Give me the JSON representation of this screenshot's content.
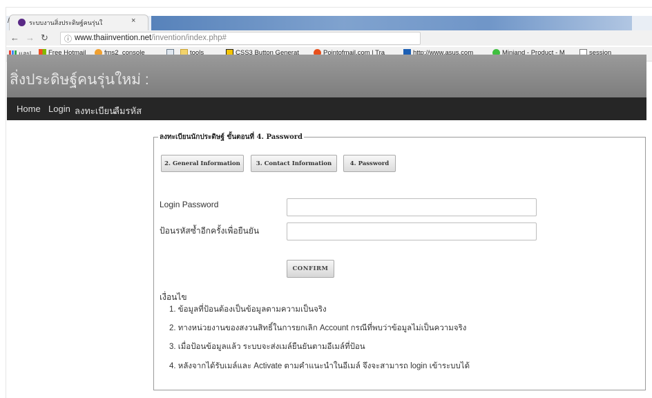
{
  "browser": {
    "tab_lead": "/",
    "tab_title": "ระบบงานสิ่งประดิษฐ์คนรุ่นใ",
    "tab_close": "×",
    "url_host": "www.thaiinvention.net",
    "url_path": "/invention/index.php#",
    "bookmarks": [
      {
        "label": "แอป",
        "icon": "apps-icon"
      },
      {
        "label": "Free Hotmail",
        "icon": "windows-icon"
      },
      {
        "label": "fms2_console",
        "icon": "flower-icon"
      },
      {
        "label": "",
        "icon": "image-icon"
      },
      {
        "label": "tools",
        "icon": "folder-icon"
      },
      {
        "label": "CSS3 Button Generat",
        "icon": "css-icon"
      },
      {
        "label": "Pointofmail.com | Tra",
        "icon": "circle-icon"
      },
      {
        "label": "http://www.asus.com",
        "icon": "link-icon"
      },
      {
        "label": "Miniand - Product - M",
        "icon": "green-circle-icon"
      },
      {
        "label": "session",
        "icon": "page-icon"
      }
    ]
  },
  "site": {
    "title": "สิ่งประดิษฐ์คนรุ่นใหม่ :",
    "nav": [
      "Home",
      "Login",
      "ลงทะเบียน",
      "ลืมรหัส"
    ]
  },
  "form": {
    "legend": "ลงทะเบียนนักประดิษฐ์ ขั้นตอนที่ 4. Password",
    "steps": [
      "2. General Information",
      "3. Contact Information",
      "4. Password"
    ],
    "password_label": "Login Password",
    "confirm_label": "ป้อนรหัสซ้ำอีกครั้งเพื่อยืนยัน",
    "password_value": "",
    "confirm_value": "",
    "confirm_button": "CONFIRM",
    "conditions_title": "เงื่อนไข",
    "conditions": [
      "1. ข้อมูลที่ป้อนต้องเป็นข้อมูลตามความเป็นจริง",
      "2. ทางหน่วยงานของสงวนสิทธิ์ในการยกเลิก Account กรณีที่พบว่าข้อมูลไม่เป็นความจริง",
      "3. เมื่อป้อนข้อมูลแล้ว ระบบจะส่งเมล์ยืนยันตามอีเมล์ที่ป้อน",
      "4. หลังจากได้รับเมล์และ Activate ตามคำแนะนำในอีเมล์ จึงจะสามารถ login เข้าระบบได้"
    ]
  },
  "colors": {
    "header_bg": "#8a8a8a",
    "nav_bg": "#262626",
    "tab_bar": "#3d6fb0"
  }
}
